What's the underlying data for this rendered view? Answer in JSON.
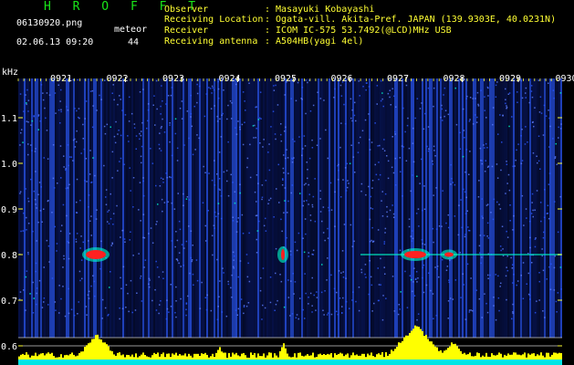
{
  "header": {
    "app_title": "H R O F F T",
    "filename": "06130920.png",
    "meteor_label": "meteor",
    "datetime": "02.06.13 09:20",
    "meteor_count": "44",
    "fields": [
      {
        "label": "Observer",
        "value": ": Masayuki Kobayashi"
      },
      {
        "label": "Receiving Location",
        "value": ": Ogata-vill. Akita-Pref. JAPAN (139.9303E, 40.0231N)"
      },
      {
        "label": "Receiver",
        "value": ": ICOM IC-575 53.7492(@LCD)MHz USB"
      },
      {
        "label": "Receiving antenna",
        "value": ": A504HB(yagi 4el)"
      }
    ]
  },
  "spectrogram": {
    "y_unit": "kHz",
    "y_ticks": [
      "1.1",
      "1.0",
      "0.9",
      "0.8",
      "0.7",
      "0.6"
    ],
    "x_ticks": [
      "0921",
      "0922",
      "0923",
      "0924",
      "0925",
      "0926",
      "0927",
      "0928",
      "0929",
      "0930"
    ],
    "colors": {
      "background": "#000000",
      "noise_dark": "#0a1a6e",
      "noise_light": "#2a58ff",
      "tick_color": "#ffff33",
      "signal_hot": "#ff2020",
      "signal_mid": "#00ffcc",
      "histogram": "#ffff00",
      "histogram_base": "#00e5e5"
    }
  }
}
